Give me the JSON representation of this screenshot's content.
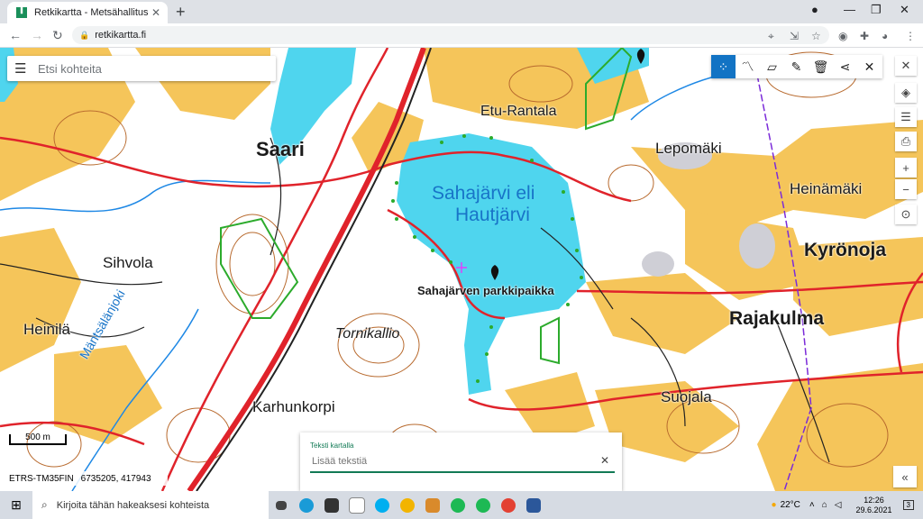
{
  "browser": {
    "tab_title": "Retkikartta - Metsähallitus",
    "tab_close": "✕",
    "new_tab": "+",
    "url": "retkikartta.fi",
    "window_controls": {
      "minimize": "—",
      "restore": "❐",
      "close": "✕"
    }
  },
  "search": {
    "placeholder": "Etsi kohteita"
  },
  "map_labels": {
    "lake": "Sahajärvi eli Hautjärvi",
    "parking": "Sahajärven parkkipaikka",
    "places": [
      "Etu-Rantala",
      "Saari",
      "Lepomäki",
      "Heinämäki",
      "Kyrönoja",
      "Sihvola",
      "Rajakulma",
      "Heinilä",
      "Tornikallio",
      "Suojala",
      "Karhunkorpi",
      "Mäntsälänjoki"
    ]
  },
  "scale": "500 m",
  "coordinates": {
    "crs": "ETRS-TM35FIN",
    "value": "6735205, 417943"
  },
  "text_panel": {
    "label": "Teksti kartalla",
    "placeholder": "Lisää tekstiä",
    "clear": "✕"
  },
  "collapse_label": "«",
  "taskbar": {
    "search_placeholder": "Kirjoita tähän hakeaksesi kohteista",
    "temperature": "22°C",
    "time": "12:26",
    "date": "29.6.2021",
    "notification_count": "3"
  },
  "colors": {
    "water": "#4fd5ee",
    "field": "#f5c55a",
    "road": "#e0232b",
    "accent": "#1273c4"
  }
}
